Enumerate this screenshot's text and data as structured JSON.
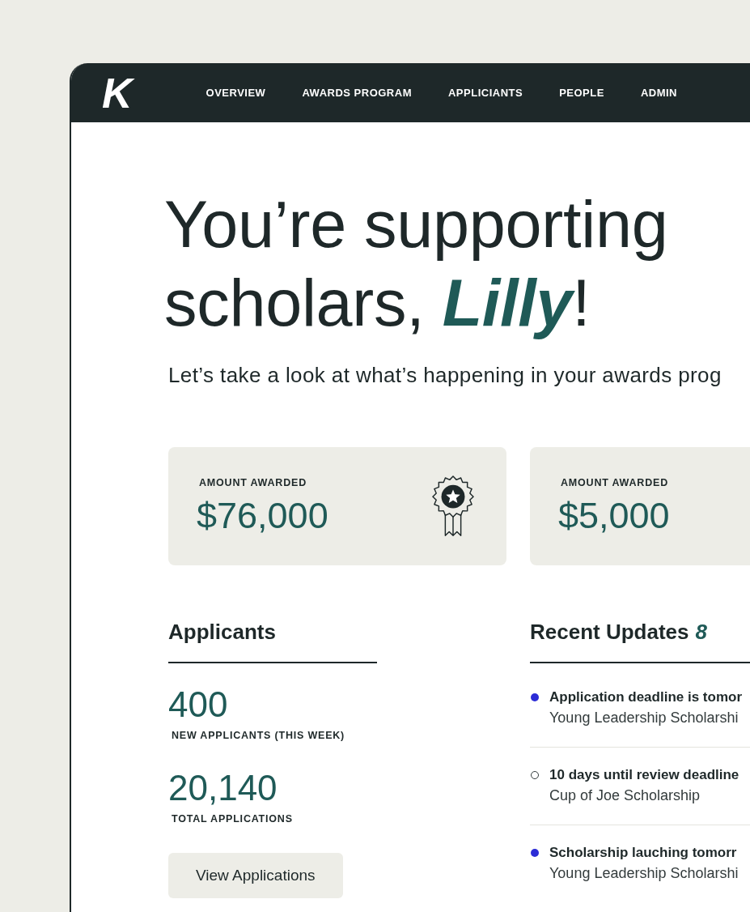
{
  "nav": {
    "logo": "K",
    "items": [
      {
        "label": "OVERVIEW"
      },
      {
        "label": "AWARDS PROGRAM"
      },
      {
        "label": "APPLICIANTS"
      },
      {
        "label": "PEOPLE"
      },
      {
        "label": "ADMIN"
      }
    ]
  },
  "hero": {
    "headline": "You’re supporting scholars, *Lilly*!",
    "subtitle": "Let’s take a look at what’s happening in your awards prog"
  },
  "stat_cards": [
    {
      "kind": "with-icon",
      "label": "AMOUNT AWARDED",
      "value": "$76,000"
    },
    {
      "kind": "plain",
      "label": "AMOUNT AWARDED",
      "value": "$5,000"
    }
  ],
  "applicants": {
    "title": "Applicants",
    "stats": [
      {
        "value": "400",
        "label": "NEW APPLICANTS (THIS WEEK)"
      },
      {
        "value": "20,140",
        "label": "TOTAL APPLICATIONS"
      }
    ],
    "button": "View Applications"
  },
  "recent_updates": {
    "title": "Recent Updates",
    "count": "8",
    "items": [
      {
        "title": "Application deadline is tomor",
        "subtitle": "Young Leadership Scholarshi",
        "unread": true
      },
      {
        "title": "10 days until review deadline",
        "subtitle": "Cup of Joe Scholarship",
        "unread": false
      },
      {
        "title": "Scholarship lauching tomorr",
        "subtitle": "Young Leadership Scholarshi",
        "unread": true
      }
    ]
  }
}
